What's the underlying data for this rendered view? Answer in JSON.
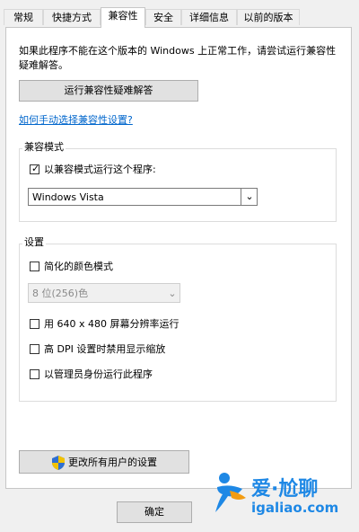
{
  "tabs": [
    "常规",
    "快捷方式",
    "兼容性",
    "安全",
    "详细信息",
    "以前的版本"
  ],
  "description": "如果此程序不能在这个版本的 Windows 上正常工作，请尝试运行兼容性疑难解答。",
  "run_troubleshooter_button": "运行兼容性疑难解答",
  "manual_link": "如何手动选择兼容性设置?",
  "compat_mode": {
    "title": "兼容模式",
    "checkbox_label": "以兼容模式运行这个程序:",
    "checked": true,
    "selected_os": "Windows Vista"
  },
  "settings": {
    "title": "设置",
    "reduced_color": {
      "label": "简化的颜色模式",
      "checked": false
    },
    "color_depth_selected": "8 位(256)色",
    "run_640": {
      "label": "用 640 x 480 屏幕分辨率运行",
      "checked": false
    },
    "high_dpi": {
      "label": "高 DPI 设置时禁用显示缩放",
      "checked": false
    },
    "run_as_admin": {
      "label": "以管理员身份运行此程序",
      "checked": false
    }
  },
  "change_all_users_button": "更改所有用户的设置",
  "footer": {
    "ok_button": "确定"
  },
  "watermark": {
    "line1": "爱·尬聊",
    "line2": "igaliao.com"
  },
  "colors": {
    "link": "#0066cc",
    "logo_blue": "#1e88e5",
    "logo_orange": "#f39c12"
  },
  "icons": {
    "shield": "uac-shield-icon",
    "dropdown": "chevron-down-icon"
  }
}
